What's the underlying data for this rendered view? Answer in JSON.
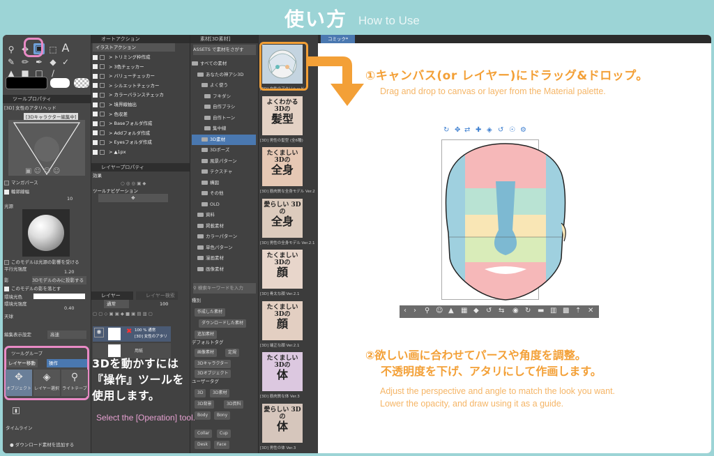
{
  "header": {
    "title": "使い方",
    "subtitle": "How to Use"
  },
  "colors": {
    "accent_orange": "#f3a037",
    "accent_pink": "#e98ac5",
    "teal_bg": "#9cd4d6",
    "selection_blue": "#4a78b0"
  },
  "tool_palette": {
    "text_tool_glyph": "A",
    "tool_property_header": "ツールプロパティ",
    "sub_tool_name": "[3D] 女性のアタリヘッド",
    "preview_label": "[3Dキャラクター編集中]",
    "manga_perspective": "マンガパース",
    "outline_width_label": "輪郭線幅",
    "outline_width_value": "10",
    "light_source_label": "光源",
    "light_affected_label": "このモデルは光源の影響を受ける",
    "parallel_light_label": "平行光強度",
    "parallel_light_value": "1.20",
    "shadow_label": "影",
    "shadow_value": "3Dモデルのみに投影する",
    "cast_shadow_label": "このモデルの影を落とす",
    "ambient_color_label": "環境光色",
    "ambient_strength_label": "環境光強度",
    "ambient_strength_value": "0.40",
    "sky_label": "天球",
    "edit_display_label": "編集表示設定",
    "edit_display_value": "高速",
    "tool_group_header": "ツールグループ",
    "tab_layer_move": "レイヤー移動",
    "tab_operation": "操作",
    "btn_object": "オブジェクト",
    "btn_layer_select": "レイヤー選択",
    "btn_light_table": "ライトテーブ",
    "timeline": "タイムライン",
    "download_material": "ダウンロード素材を追加する"
  },
  "auto_action": {
    "header": "オートアクション",
    "set_name": "イラストアクション",
    "items": [
      "トリミング枠作成",
      "3色チェッカー",
      "バリューチェッカー",
      "シルエットチェッカー",
      "カラーバランスチェッカ",
      "境界線抽出",
      "色収差",
      "Baseフォルダ作成",
      "Addフォルダ作成",
      "Eyesフォルダ作成",
      "▲1px"
    ]
  },
  "layer_property": {
    "header": "レイヤープロパティ",
    "effect": "効果",
    "tool_nav": "ツールナビゲーション"
  },
  "layer_panel": {
    "tab_layer": "レイヤー",
    "tab_search": "レイヤー検索",
    "blend_mode": "通常",
    "opacity": "100",
    "layer1_line1": "100 % 通常",
    "layer1_line2": "[3D] 女性のアタリ",
    "layer2_name": "用紙"
  },
  "material_tree": {
    "header": "素材[3D素材]",
    "search_assets": "ASSETS で素材をさがす",
    "items": [
      "すべての素材",
      "あなたの神アシ3D",
      "よく使う",
      "フキダシ",
      "自作ブラシ",
      "自作トーン",
      "集中線",
      "3D素材",
      "3Dポーズ",
      "風景パターン",
      "テクスチャ",
      "構図",
      "その他",
      "OLD",
      "資料",
      "掲載素材",
      "カラーパターン",
      "単色パターン",
      "漫画素材",
      "画像素材"
    ],
    "search_placeholder": "検索キーワードを入力",
    "type_label": "種別",
    "tag_created": "作成した素材",
    "tag_downloaded": "ダウンロードした素材",
    "tag_added": "追加素材",
    "default_tag": "デフォルトタグ",
    "tag_image": "画像素材",
    "tag_fixed": "定規",
    "tag_3dchar": "3Dキャラクター",
    "tag_3dobj": "3Dオブジェクト",
    "user_tag": "ユーザータグ",
    "tag_3d": "3D",
    "tag_3dmat": "3D素材",
    "tag_3dbg": "3D背景",
    "tag_3dmat2": "3D資料",
    "tag_body": "Body",
    "tag_bony": "Bony",
    "tag_collar": "Collar",
    "tag_cup": "Cup",
    "tag_desk": "Desk",
    "tag_face": "Face"
  },
  "materials": [
    {
      "line1": "",
      "line2": "",
      "caption": "[3D] 女性のアタリヘッド"
    },
    {
      "line1": "よくわかる 3Dの",
      "line2": "髪型",
      "caption": "[3D] 男性の髪型 (全6種)"
    },
    {
      "line1": "たくましい 3Dの",
      "line2": "全身",
      "caption": "[3D] 筋肉質な全身モデル Ver.2"
    },
    {
      "line1": "愛らしい 3Dの",
      "line2": "全身",
      "caption": "[3D] 男性の全身モデル Ver.2.1"
    },
    {
      "line1": "たくましい 3Dの",
      "line2": "顔",
      "caption": "[3D] 骨太な顔 Ver.2.1"
    },
    {
      "line1": "たくましい 3Dの",
      "line2": "顔",
      "caption": "[3D] 端正な顔 Ver.2.1"
    },
    {
      "line1": "たくましい 3Dの",
      "line2": "体",
      "caption": "[3D] 筋肉質な体 Ver.3"
    },
    {
      "line1": "愛らしい 3Dの",
      "line2": "体",
      "caption": "[3D] 男性の体 Ver.3"
    }
  ],
  "canvas": {
    "tab_label": "コミック*",
    "step1_title": "①キャンバス(or レイヤー)にドラッグ&ドロップ。",
    "step1_en": "Drag and drop to canvas or layer from the Material palette.",
    "step2_line1": "②欲しい画に合わせてパースや角度を調整。",
    "step2_line2": "不透明度を下げ、アタリにして作画します。",
    "step2_en_line1": "Adjust the perspective and angle to match the look you want.",
    "step2_en_line2": "Lower the opacity, and draw using it as a guide."
  },
  "callout": {
    "line1": "3Dを動かすには",
    "line2": "『操作』ツールを",
    "line3": "使用します。",
    "en": "Select the [Operation] tool."
  }
}
